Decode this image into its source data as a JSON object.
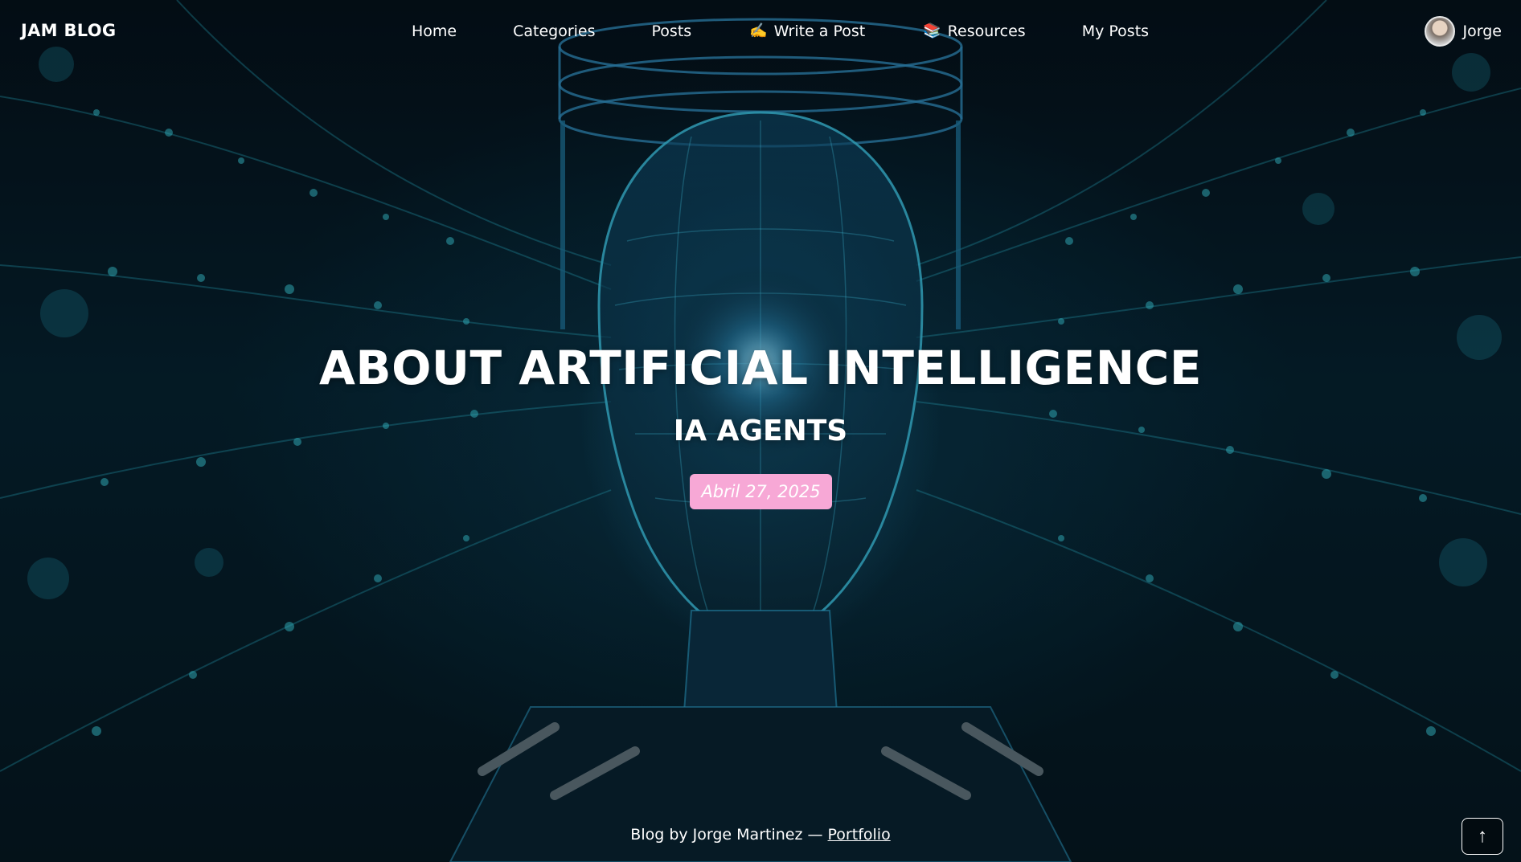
{
  "brand": "JAM BLOG",
  "nav": {
    "items": [
      {
        "label": "Home",
        "icon": ""
      },
      {
        "label": "Categories",
        "icon": ""
      },
      {
        "label": "Posts",
        "icon": ""
      },
      {
        "label": "Write a Post",
        "icon": "✍️"
      },
      {
        "label": "Resources",
        "icon": "📚"
      },
      {
        "label": "My Posts",
        "icon": ""
      }
    ]
  },
  "user": {
    "name": "Jorge",
    "avatar_icon": "user-avatar"
  },
  "hero": {
    "title": "ABOUT ARTIFICIAL INTELLIGENCE",
    "subtitle": "IA AGENTS",
    "date": "Abril 27, 2025",
    "background_description": "",
    "date_badge_color": "#f7a8d6"
  },
  "footer": {
    "text": "Blog by Jorge Martinez — ",
    "link_label": "Portfolio"
  },
  "back_to_top": {
    "glyph": "↑",
    "icon": "arrow-up-icon"
  }
}
